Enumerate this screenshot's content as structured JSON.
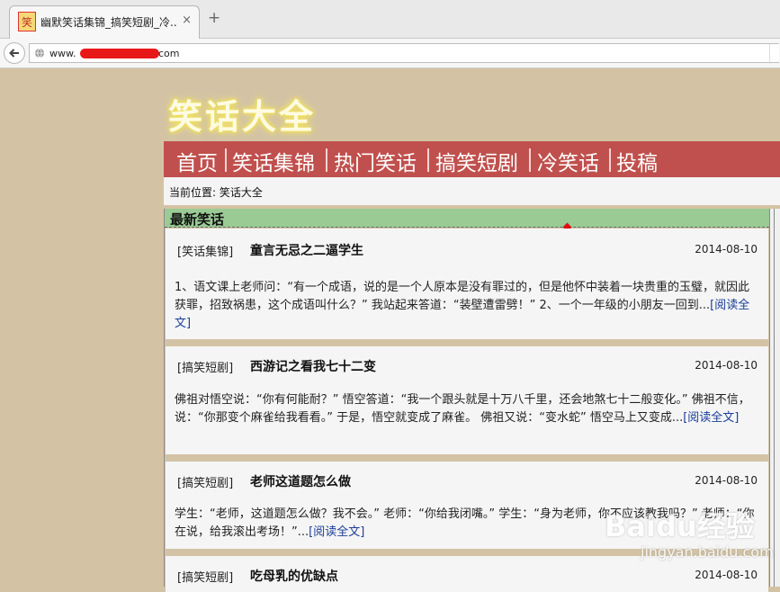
{
  "browser": {
    "tab_title": "幽默笑话集锦_搞笑短剧_冷...",
    "favicon_char": "笑",
    "close_glyph": "×",
    "new_tab_glyph": "+",
    "url_prefix": "www.",
    "url_suffix": "com"
  },
  "site": {
    "logo": "笑话大全",
    "nav": [
      "首页",
      "笑话集锦",
      "热门笑话",
      "搞笑短剧",
      "冷笑话",
      "投稿"
    ],
    "breadcrumb": "当前位置: 笑话大全"
  },
  "section": {
    "title": "最新笑话",
    "read_more": "[阅读全文]",
    "articles": [
      {
        "category": "[笑话集锦]",
        "title": "童言无忌之二逼学生",
        "date": "2014-08-10",
        "excerpt": "1、语文课上老师问：“有一个成语，说的是一个人原本是没有罪过的，但是他怀中装着一块贵重的玉璧，就因此获罪，招致祸患，这个成语叫什么？” 我站起来答道：“装壁遭雷劈！” 2、一个一年级的小朋友一回到..."
      },
      {
        "category": "[搞笑短剧]",
        "title": "西游记之看我七十二变",
        "date": "2014-08-10",
        "excerpt": "佛祖对悟空说：“你有何能耐？” 悟空答道：“我一个跟头就是十万八千里，还会地煞七十二般变化。” 佛祖不信，说：“你那变个麻雀给我看看。” 于是，悟空就变成了麻雀。 佛祖又说：“变水蛇” 悟空马上又变成..."
      },
      {
        "category": "[搞笑短剧]",
        "title": "老师这道题怎么做",
        "date": "2014-08-10",
        "excerpt": "学生：“老师，这道题怎么做？我不会。” 老师：“你给我闭嘴。” 学生：“身为老师，你不应该教我吗？” 老师：“你在说，给我滚出考场！”..."
      },
      {
        "category": "[搞笑短剧]",
        "title": "吃母乳的优缺点",
        "date": "2014-08-10",
        "excerpt": ""
      }
    ]
  },
  "watermark": {
    "main": "Baidu经验",
    "sub": "jingyan.baidu.com"
  },
  "colors": {
    "nav_bg": "#c0504d",
    "section_head_bg": "#9acb95",
    "page_bg": "#d3c3a4",
    "link": "#1a3d99"
  }
}
